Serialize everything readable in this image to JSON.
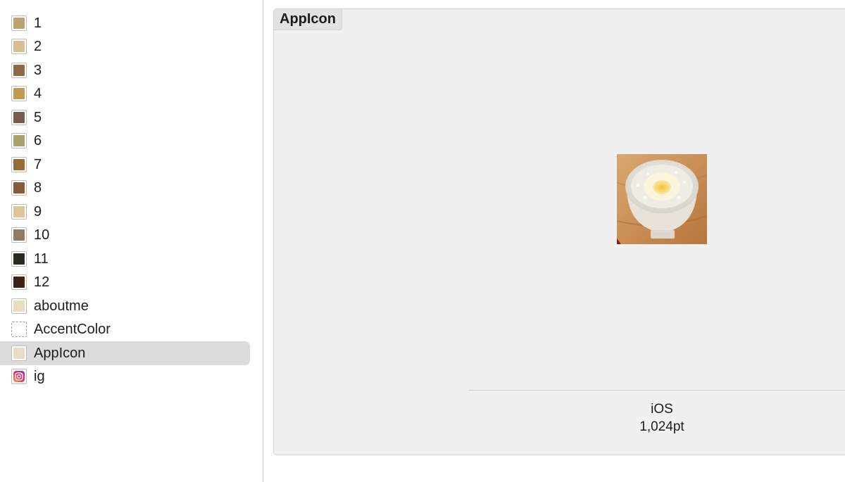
{
  "sidebar": {
    "items": [
      {
        "label": "1",
        "icon": "asset-thumbnail-icon",
        "color": "#b9a66f"
      },
      {
        "label": "2",
        "icon": "asset-thumbnail-icon",
        "color": "#d8c08a"
      },
      {
        "label": "3",
        "icon": "asset-thumbnail-icon",
        "color": "#8c6a45"
      },
      {
        "label": "4",
        "icon": "asset-thumbnail-icon",
        "color": "#c49a52"
      },
      {
        "label": "5",
        "icon": "asset-thumbnail-icon",
        "color": "#7a5a4a"
      },
      {
        "label": "6",
        "icon": "asset-thumbnail-icon",
        "color": "#a9a26c"
      },
      {
        "label": "7",
        "icon": "asset-thumbnail-icon",
        "color": "#9a6a36"
      },
      {
        "label": "8",
        "icon": "asset-thumbnail-icon",
        "color": "#8a5a3c"
      },
      {
        "label": "9",
        "icon": "asset-thumbnail-icon",
        "color": "#e0c49a"
      },
      {
        "label": "10",
        "icon": "asset-thumbnail-icon",
        "color": "#8f7a66"
      },
      {
        "label": "11",
        "icon": "asset-thumbnail-icon",
        "color": "#2a2a22"
      },
      {
        "label": "12",
        "icon": "asset-thumbnail-icon",
        "color": "#3a2416"
      },
      {
        "label": "aboutme",
        "icon": "asset-thumbnail-icon",
        "color": "#e8dcc2"
      },
      {
        "label": "AccentColor",
        "icon": "empty-color-set-icon",
        "color": "transparent"
      },
      {
        "label": "AppIcon",
        "icon": "app-icon-thumbnail-icon",
        "color": "#e7dcc4",
        "selected": true
      },
      {
        "label": "ig",
        "icon": "instagram-icon",
        "color": "#d6287a"
      }
    ]
  },
  "detail": {
    "title": "AppIcon",
    "slot_platform": "iOS",
    "slot_size": "1,024pt"
  },
  "colors": {
    "selection": "#dcdcdc",
    "panel_background": "#f0f0f0"
  }
}
